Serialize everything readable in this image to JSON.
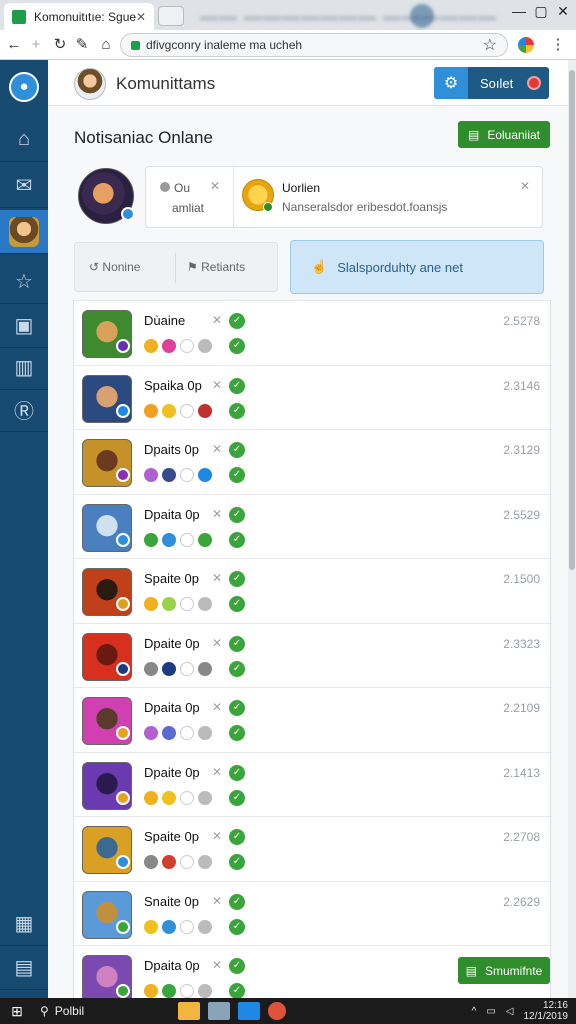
{
  "browser": {
    "tab_title": "Komonuitıtıe: Sgue",
    "tab_close": "✕",
    "address": "dfivgconry inaleme ma ucheh",
    "bookmark_icon": "star-icon",
    "window_controls": [
      "—",
      "▢",
      "✕"
    ]
  },
  "sidebar": {
    "avatar_icon": "user-icon",
    "items": [
      {
        "name": "home",
        "icon": "⌂"
      },
      {
        "name": "mail",
        "icon": "✉"
      },
      {
        "name": "game",
        "icon": ""
      },
      {
        "name": "favorites",
        "icon": "☆"
      },
      {
        "name": "photos",
        "icon": "▣"
      },
      {
        "name": "reports",
        "icon": "▥"
      },
      {
        "name": "badge",
        "icon": "Ⓡ"
      }
    ],
    "bottom_items": [
      {
        "name": "grid",
        "icon": "▦"
      },
      {
        "name": "panel",
        "icon": "▤"
      }
    ]
  },
  "header": {
    "app_name": "Komunittams",
    "settings_label": "Soılet"
  },
  "page": {
    "title": "Notisaniac Onlane",
    "export_label": "Eoluaniiat",
    "submit_label": "Smumifnte"
  },
  "notice": {
    "left_top": "Ou",
    "left_bottom": "amliat",
    "title": "Uorlien",
    "subtitle": "Nanseralsdor eribesdot.foansjs"
  },
  "filters": {
    "nonline": "Nonine",
    "retiants": "Retiants",
    "cta": "Slalsporduhty ane net"
  },
  "rows": [
    {
      "name": "Dùaine",
      "number": "2.5278"
    },
    {
      "name": "Spaika 0p",
      "number": "2.3146"
    },
    {
      "name": "Dpaits 0p",
      "number": "2.3129"
    },
    {
      "name": "Dpaita 0p",
      "number": "2.5529"
    },
    {
      "name": "Spaite 0p",
      "number": "2.1500"
    },
    {
      "name": "Dpaite 0p",
      "number": "2.3323"
    },
    {
      "name": "Dpaita 0p",
      "number": "2.2109"
    },
    {
      "name": "Dpaite 0p",
      "number": "2.1413"
    },
    {
      "name": "Spaite 0p",
      "number": "2.2708"
    },
    {
      "name": "Snaite 0p",
      "number": "2.2629"
    },
    {
      "name": "Dpaita 0p",
      "number": ""
    }
  ],
  "taskbar": {
    "search": "Polbil",
    "time": "12:16",
    "date": "12/1/2019"
  }
}
